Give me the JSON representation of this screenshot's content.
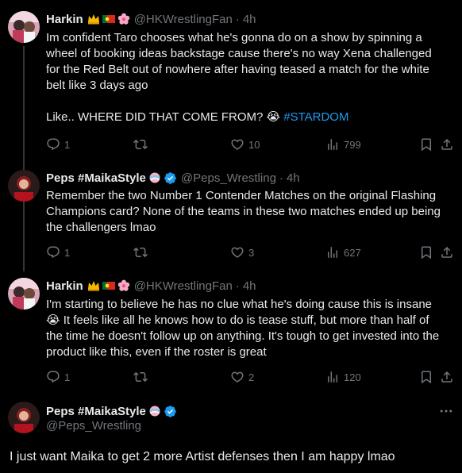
{
  "tweets": [
    {
      "name": "Harkin",
      "handle": "@HKWrestlingFan",
      "time": "4h",
      "text_lines": [
        "Im confident Taro chooses what he's gonna do on a show by spinning a",
        "wheel of booking ideas backstage cause there's no way Xena challenged",
        "for the Red Belt out of nowhere after having teased a match for the white",
        "belt like 3 days ago"
      ],
      "text_line2_prefix": "Like.. WHERE DID THAT COME FROM? 😭 ",
      "hashtag": "#STARDOM",
      "replies": "1",
      "retweets": "",
      "likes": "10",
      "views": "799"
    },
    {
      "name": "Peps #MaikaStyle",
      "handle": "@Peps_Wrestling",
      "time": "4h",
      "text_lines": [
        "Remember the two Number 1 Contender Matches on the original Flashing",
        "Champions card? None of the teams in these two matches ended up being",
        "the challengers lmao"
      ],
      "replies": "1",
      "retweets": "",
      "likes": "3",
      "views": "627"
    },
    {
      "name": "Harkin",
      "handle": "@HKWrestlingFan",
      "time": "4h",
      "text_lines": [
        "I'm starting to believe he has no clue what he's doing cause this is insane",
        "😭 It feels like all he knows how to do is tease stuff, but more than half of",
        "the time he doesn't follow up on anything. It's tough to get invested into the",
        "product like this, even if the roster is great"
      ],
      "replies": "1",
      "retweets": "",
      "likes": "2",
      "views": "120"
    }
  ],
  "main_tweet": {
    "name": "Peps #MaikaStyle",
    "handle": "@Peps_Wrestling",
    "text": "I just want Maika to get 2 more Artist defenses then I am happy lmao"
  },
  "colors": {
    "background": "#000000",
    "text": "#e7e9ea",
    "muted": "#71767b",
    "link": "#1d9bf0",
    "verified": "#1d9bf0"
  }
}
